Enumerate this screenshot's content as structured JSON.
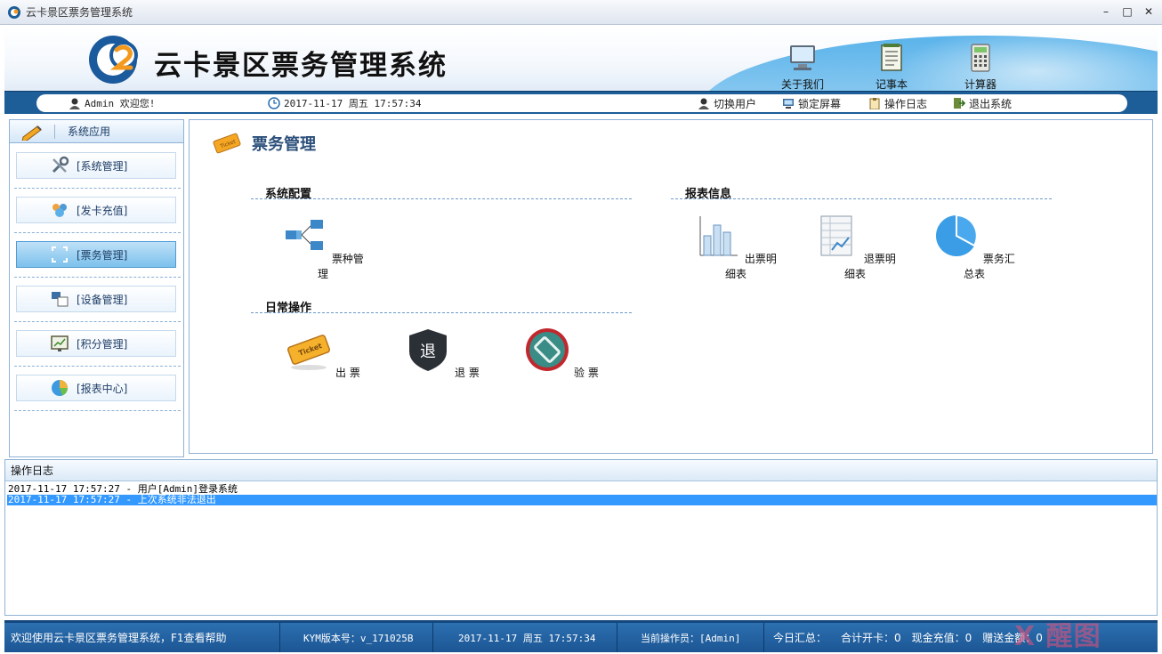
{
  "window": {
    "title": "云卡景区票务管理系统",
    "minimize": "–",
    "maximize": "□",
    "close": "✕"
  },
  "header": {
    "app_title": "云卡景区票务管理系统",
    "buttons": [
      {
        "label": "关于我们",
        "icon": "monitor-icon"
      },
      {
        "label": "记事本",
        "icon": "notepad-icon"
      },
      {
        "label": "计算器",
        "icon": "calculator-icon"
      }
    ]
  },
  "toolbar": {
    "welcome": "Admin 欢迎您!",
    "datetime": "2017-11-17 周五 17:57:34",
    "switch_user": "切换用户",
    "lock_screen": "锁定屏幕",
    "operation_log": "操作日志",
    "exit_system": "退出系统"
  },
  "sidebar": {
    "header": "系统应用",
    "items": [
      {
        "label": "[系统管理]",
        "icon": "tools-icon"
      },
      {
        "label": "[发卡充值]",
        "icon": "users-icon"
      },
      {
        "label": "[票务管理]",
        "icon": "frame-icon",
        "active": true
      },
      {
        "label": "[设备管理]",
        "icon": "device-icon"
      },
      {
        "label": "[积分管理]",
        "icon": "chart-board-icon"
      },
      {
        "label": "[报表中心]",
        "icon": "pie-chart-icon"
      }
    ]
  },
  "main": {
    "title": "票务管理",
    "sections": {
      "config": {
        "title": "系统配置",
        "items": [
          {
            "label": "票种管理",
            "icon": "hierarchy-icon"
          }
        ]
      },
      "daily": {
        "title": "日常操作",
        "items": [
          {
            "label": "出 票",
            "icon": "ticket-icon"
          },
          {
            "label": "退 票",
            "icon": "refund-shield-icon",
            "glyph": "退"
          },
          {
            "label": "验 票",
            "icon": "verify-ticket-icon"
          }
        ]
      },
      "reports": {
        "title": "报表信息",
        "items": [
          {
            "label": "出票明细表",
            "icon": "bar-chart-icon"
          },
          {
            "label": "退票明细表",
            "icon": "spreadsheet-icon"
          },
          {
            "label": "票务汇总表",
            "icon": "pie-icon"
          }
        ]
      }
    }
  },
  "log_panel": {
    "title": "操作日志",
    "lines": [
      {
        "text": "2017-11-17 17:57:27 - 用户[Admin]登录系统",
        "selected": false
      },
      {
        "text": "2017-11-17 17:57:27 - 上次系统非法退出",
        "selected": true
      }
    ]
  },
  "status": {
    "help": "欢迎使用云卡景区票务管理系统，F1查看帮助",
    "version": "KYM版本号：v_171025B",
    "datetime": "2017-11-17 周五 17:57:34",
    "operator": "当前操作员：[Admin]",
    "summary": "今日汇总：",
    "total_cards": "合计开卡：0",
    "cash_recharge": "现金充值：0",
    "gift_amount": "赠送金额：0"
  },
  "watermark": "X 醒图",
  "colors": {
    "accent": "#1d5d98",
    "title": "#2b4f7a",
    "selection": "#3399ff"
  }
}
